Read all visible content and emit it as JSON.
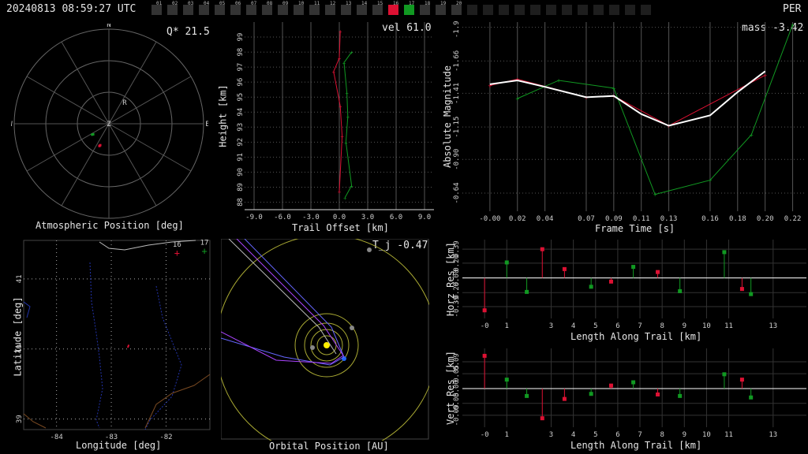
{
  "header": {
    "timestamp": "20240813 08:59:27 UTC",
    "station": "PER"
  },
  "cameras": {
    "labels": [
      "01",
      "02",
      "03",
      "04",
      "05",
      "06",
      "07",
      "08",
      "09",
      "10",
      "11",
      "12",
      "13",
      "14",
      "15",
      "16",
      "17",
      "18",
      "19",
      "20"
    ],
    "highlight_red": "16",
    "highlight_green": "17"
  },
  "colors": {
    "primary": "#dd1133",
    "secondary": "#119922",
    "grid": "#555555",
    "fit": "#ffffff",
    "sun": "#ffee00",
    "ring": "#aaaa33"
  },
  "panels": {
    "atmo": {
      "title": "Atmospheric Position [deg]",
      "stat": "Q* 21.5",
      "compass": [
        "N",
        "E",
        "S",
        "W",
        "Z"
      ],
      "marker": "R"
    },
    "height": {
      "xlabel": "Trail Offset [km]",
      "ylabel": "Height [km]",
      "stat": "vel 61.0"
    },
    "mag": {
      "xlabel": "Frame Time [s]",
      "ylabel": "Absolute Magnitude",
      "stat": "mass -3.42"
    },
    "map": {
      "xlabel": "Longitude [deg]",
      "ylabel": "Latitude [deg]",
      "site_labels": [
        "16",
        "17"
      ]
    },
    "orbit": {
      "xlabel": "Orbital Position [AU]",
      "stat": "T_j -0.47"
    },
    "horz": {
      "xlabel": "Length Along Trail [km]",
      "ylabel": "Horz Res [km]"
    },
    "vert": {
      "xlabel": "Length Along Trail [km]",
      "ylabel": "Vert Res [km]"
    }
  },
  "chart_data": [
    {
      "type": "scatter",
      "name": "atmospheric-position",
      "title": "Atmospheric Position [deg]",
      "compass": [
        "N",
        "E",
        "S",
        "W"
      ],
      "series": [
        {
          "color": "#dd1133",
          "points": [
            [
              202,
              68
            ],
            [
              203,
              67
            ]
          ]
        },
        {
          "color": "#119922",
          "points": [
            [
              236,
              72
            ],
            [
              237,
              71
            ]
          ]
        }
      ]
    },
    {
      "type": "line",
      "name": "height-vs-offset",
      "xlabel": "Trail Offset [km]",
      "ylabel": "Height [km]",
      "xlim": [
        -10,
        10
      ],
      "ylim": [
        87.5,
        100
      ],
      "xticks": [
        "-9.0",
        "-6.0",
        "-3.0",
        "0.0",
        "3.0",
        "6.0",
        "9.0"
      ],
      "yticks": [
        "88",
        "89",
        "90",
        "91",
        "92",
        "93",
        "94",
        "95",
        "96",
        "97",
        "98",
        "99"
      ],
      "series": [
        {
          "color": "#dd1133",
          "points": [
            [
              0.1,
              99.4
            ],
            [
              0.0,
              97.6
            ],
            [
              -0.6,
              96.7
            ],
            [
              0.1,
              94.4
            ],
            [
              0.3,
              92.4
            ],
            [
              0.0,
              88.7
            ]
          ]
        },
        {
          "color": "#119922",
          "points": [
            [
              1.3,
              98.0
            ],
            [
              0.5,
              97.3
            ],
            [
              0.8,
              95.3
            ],
            [
              0.9,
              93.7
            ],
            [
              0.7,
              92.0
            ],
            [
              1.3,
              89.1
            ],
            [
              0.6,
              88.3
            ]
          ]
        }
      ]
    },
    {
      "type": "line",
      "name": "magnitude-vs-time",
      "xlabel": "Frame Time [s]",
      "ylabel": "Absolute Magnitude",
      "xlim": [
        -0.02,
        0.23
      ],
      "ylim": [
        -0.5,
        -1.96
      ],
      "xticks": [
        "-0.00",
        "0.02",
        "0.04",
        "0.07",
        "0.09",
        "0.11",
        "0.13",
        "0.16",
        "0.18",
        "0.20",
        "0.22"
      ],
      "yticks": [
        "-1.92",
        "-1.66",
        "-1.41",
        "-1.15",
        "-0.90",
        "-0.64"
      ],
      "series": [
        {
          "color": "#dd1133",
          "points": [
            [
              -0.0,
              -1.47
            ],
            [
              0.02,
              -1.52
            ],
            [
              0.07,
              -1.38
            ],
            [
              0.09,
              -1.39
            ],
            [
              0.13,
              -1.16
            ],
            [
              0.2,
              -1.55
            ]
          ]
        },
        {
          "color": "#119922",
          "points": [
            [
              0.02,
              -1.37
            ],
            [
              0.05,
              -1.51
            ],
            [
              0.09,
              -1.45
            ],
            [
              0.12,
              -0.63
            ],
            [
              0.16,
              -0.74
            ],
            [
              0.19,
              -1.09
            ],
            [
              0.22,
              -1.94
            ]
          ]
        },
        {
          "color": "#ffffff",
          "points": [
            [
              -0.0,
              -1.48
            ],
            [
              0.02,
              -1.51
            ],
            [
              0.04,
              -1.46
            ],
            [
              0.07,
              -1.38
            ],
            [
              0.09,
              -1.39
            ],
            [
              0.11,
              -1.25
            ],
            [
              0.13,
              -1.16
            ],
            [
              0.16,
              -1.24
            ],
            [
              0.18,
              -1.42
            ],
            [
              0.2,
              -1.58
            ]
          ]
        }
      ]
    },
    {
      "type": "map",
      "name": "ground-track",
      "xlabel": "Longitude [deg]",
      "ylabel": "Latitude [deg]",
      "xlim": [
        -84.6,
        -81.2
      ],
      "ylim": [
        38.85,
        41.55
      ],
      "xticks": [
        "-84",
        "-83",
        "-82"
      ],
      "yticks": [
        "39",
        "40",
        "41"
      ],
      "sites": [
        {
          "label": "16",
          "lon": -81.8,
          "lat": 41.37,
          "color": "#dd1133"
        },
        {
          "label": "17",
          "lon": -81.3,
          "lat": 41.4,
          "color": "#119922"
        }
      ],
      "track": [
        [
          -82.68,
          40.06
        ],
        [
          -82.7,
          40.02
        ]
      ]
    },
    {
      "type": "scatter",
      "name": "residuals-horizontal",
      "xlabel": "Length Along Trail [km]",
      "ylabel": "Horz Res [km]",
      "xlim": [
        -1,
        14.5
      ],
      "ylim": [
        -0.55,
        0.52
      ],
      "xticks": [
        "-0",
        "1",
        "3",
        "4",
        "5",
        "6",
        "7",
        "8",
        "9",
        "10",
        "11",
        "13"
      ],
      "yticks": [
        "0.39",
        "0.20",
        "0.00",
        "-0.20",
        "-0.39"
      ],
      "series": [
        {
          "color": "#dd1133",
          "points": [
            [
              0.0,
              -0.44
            ],
            [
              2.6,
              0.39
            ],
            [
              3.6,
              0.12
            ],
            [
              5.7,
              -0.05
            ],
            [
              7.8,
              0.08
            ],
            [
              11.6,
              -0.15
            ]
          ]
        },
        {
          "color": "#119922",
          "points": [
            [
              1.0,
              0.21
            ],
            [
              1.9,
              -0.19
            ],
            [
              4.8,
              -0.12
            ],
            [
              6.7,
              0.15
            ],
            [
              8.8,
              -0.18
            ],
            [
              10.8,
              0.35
            ],
            [
              12.0,
              -0.22
            ]
          ]
        }
      ]
    },
    {
      "type": "scatter",
      "name": "residuals-vertical",
      "xlabel": "Length Along Trail [km]",
      "ylabel": "Vert Res [km]",
      "xlim": [
        -1,
        14.5
      ],
      "ylim": [
        -0.13,
        0.135
      ],
      "xticks": [
        "-0",
        "1",
        "3",
        "4",
        "5",
        "6",
        "7",
        "8",
        "9",
        "10",
        "11",
        "13"
      ],
      "yticks": [
        "0.09",
        "0.05",
        "0.00",
        "-0.05",
        "-0.09"
      ],
      "series": [
        {
          "color": "#dd1133",
          "points": [
            [
              0.0,
              0.11
            ],
            [
              2.6,
              -0.1
            ],
            [
              3.6,
              -0.035
            ],
            [
              5.7,
              0.01
            ],
            [
              7.8,
              -0.02
            ],
            [
              11.6,
              0.03
            ]
          ]
        },
        {
          "color": "#119922",
          "points": [
            [
              1.0,
              0.03
            ],
            [
              1.9,
              -0.025
            ],
            [
              4.8,
              -0.018
            ],
            [
              6.7,
              0.021
            ],
            [
              8.8,
              -0.025
            ],
            [
              10.8,
              0.048
            ],
            [
              12.0,
              -0.03
            ]
          ]
        }
      ]
    }
  ]
}
